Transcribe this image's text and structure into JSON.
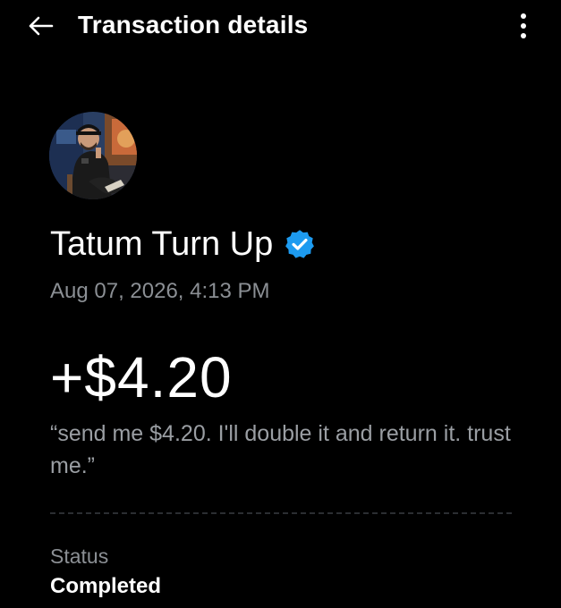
{
  "header": {
    "title": "Transaction details",
    "back_icon": "arrow-left-icon",
    "more_icon": "more-vertical-icon"
  },
  "sender": {
    "name": "Tatum Turn Up",
    "verified_icon": "verified-badge-icon",
    "verified_color": "#1d9bf0"
  },
  "transaction": {
    "timestamp": "Aug 07, 2026, 4:13 PM",
    "amount": "+$4.20",
    "note": "“send me $4.20. I'll double it and return it. trust me.”",
    "status_label": "Status",
    "status_value": "Completed"
  },
  "colors": {
    "background": "#000000",
    "primary_text": "#ffffff",
    "secondary_text": "#8b8f94"
  }
}
